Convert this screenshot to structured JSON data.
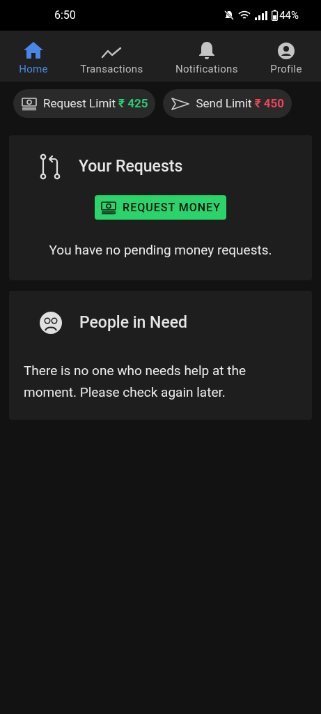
{
  "status_bar": {
    "time": "6:50",
    "battery": "44%"
  },
  "tabs": [
    {
      "label": "Home",
      "kind": "home",
      "selected": true
    },
    {
      "label": "Transactions",
      "kind": "chart",
      "selected": false
    },
    {
      "label": "Notifications",
      "kind": "bell",
      "selected": false
    },
    {
      "label": "Profile",
      "kind": "profile",
      "selected": false
    }
  ],
  "limits": [
    {
      "kind": "request",
      "label": "Request Limit",
      "amount": "₹ 425",
      "color": "#2ecc71"
    },
    {
      "kind": "send",
      "label": "Send Limit",
      "amount": "₹ 450",
      "color": "#f0435a"
    }
  ],
  "requests_card": {
    "title": "Your Requests",
    "button": "REQUEST MONEY",
    "message": "You have no pending money requests."
  },
  "people_card": {
    "title": "People in Need",
    "message": "There is no one who needs help at the moment. Please check again later."
  }
}
